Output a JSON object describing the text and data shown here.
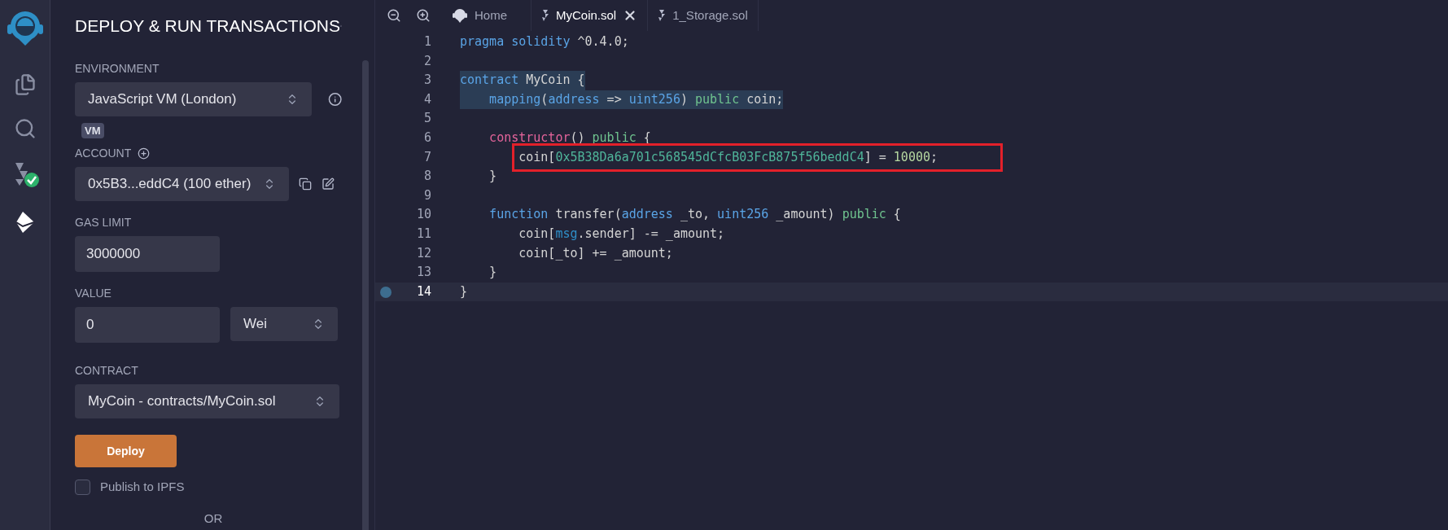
{
  "icon_bar": [
    {
      "kind": "logo"
    },
    {
      "kind": "files",
      "selected": false
    },
    {
      "kind": "search",
      "selected": false
    },
    {
      "kind": "compiler",
      "selected": false
    },
    {
      "kind": "deploy",
      "selected": true
    }
  ],
  "panel": {
    "title": "DEPLOY & RUN TRANSACTIONS",
    "environment": {
      "label": "ENVIRONMENT",
      "value": "JavaScript VM (London)",
      "badge": "VM"
    },
    "account": {
      "label": "ACCOUNT",
      "value": "0x5B3...eddC4 (100 ether)"
    },
    "gas_limit": {
      "label": "GAS LIMIT",
      "value": "3000000"
    },
    "value": {
      "label": "VALUE",
      "value": "0",
      "unit": "Wei"
    },
    "contract": {
      "label": "CONTRACT",
      "value": "MyCoin - contracts/MyCoin.sol"
    },
    "deploy_button": "Deploy",
    "publish": {
      "label": "Publish to IPFS",
      "checked": false
    },
    "separator": "OR"
  },
  "tabs": [
    {
      "label": "Home",
      "kind": "home",
      "selected": false,
      "closable": false
    },
    {
      "label": "MyCoin.sol",
      "kind": "file",
      "selected": true,
      "closable": true
    },
    {
      "label": "1_Storage.sol",
      "kind": "file",
      "selected": false,
      "closable": false
    }
  ],
  "code": [
    {
      "number": "1",
      "selected": false,
      "current": false,
      "breakpoint": false,
      "boxed": false,
      "tokens": [
        {
          "text": "pragma solidity",
          "kind": "keyword"
        },
        {
          "text": " ^0.4.0;",
          "kind": "plain"
        }
      ]
    },
    {
      "number": "2",
      "selected": false,
      "current": false,
      "breakpoint": false,
      "boxed": false
    },
    {
      "number": "3",
      "selected": true,
      "current": false,
      "breakpoint": false,
      "boxed": false,
      "tokens": [
        {
          "text": "contract",
          "kind": "keyword"
        },
        {
          "text": " MyCoin {",
          "kind": "plain"
        }
      ]
    },
    {
      "number": "4",
      "selected": true,
      "current": false,
      "breakpoint": false,
      "boxed": false,
      "tokens": [
        {
          "text": "    mapping",
          "kind": "keyword"
        },
        {
          "text": "(",
          "kind": "plain"
        },
        {
          "text": "address",
          "kind": "keyword"
        },
        {
          "text": " => ",
          "kind": "plain"
        },
        {
          "text": "uint256",
          "kind": "keyword"
        },
        {
          "text": ") ",
          "kind": "plain"
        },
        {
          "text": "public",
          "kind": "modifier"
        },
        {
          "text": " coin;",
          "kind": "plain"
        }
      ]
    },
    {
      "number": "5",
      "selected": false,
      "current": false,
      "breakpoint": false,
      "boxed": false
    },
    {
      "number": "6",
      "selected": false,
      "current": false,
      "breakpoint": false,
      "boxed": false,
      "tokens": [
        {
          "text": "    constructor",
          "kind": "special"
        },
        {
          "text": "() ",
          "kind": "plain"
        },
        {
          "text": "public",
          "kind": "modifier"
        },
        {
          "text": " {",
          "kind": "plain"
        }
      ]
    },
    {
      "number": "7",
      "selected": false,
      "current": false,
      "breakpoint": false,
      "boxed": true,
      "tokens": [
        {
          "text": "        coin[",
          "kind": "plain"
        },
        {
          "text": "0x5B38Da6a701c568545dCfcB03FcB875f56beddC4",
          "kind": "literal"
        },
        {
          "text": "] = ",
          "kind": "plain"
        },
        {
          "text": "10000",
          "kind": "number"
        },
        {
          "text": ";",
          "kind": "plain"
        }
      ]
    },
    {
      "number": "8",
      "selected": false,
      "current": false,
      "breakpoint": false,
      "boxed": false,
      "tokens": [
        {
          "text": "    }",
          "kind": "plain"
        }
      ]
    },
    {
      "number": "9",
      "selected": false,
      "current": false,
      "breakpoint": false,
      "boxed": false
    },
    {
      "number": "10",
      "selected": false,
      "current": false,
      "breakpoint": false,
      "boxed": false,
      "tokens": [
        {
          "text": "    function",
          "kind": "keyword"
        },
        {
          "text": " transfer(",
          "kind": "plain"
        },
        {
          "text": "address",
          "kind": "keyword"
        },
        {
          "text": " _to, ",
          "kind": "plain"
        },
        {
          "text": "uint256",
          "kind": "keyword"
        },
        {
          "text": " _amount) ",
          "kind": "plain"
        },
        {
          "text": "public",
          "kind": "modifier"
        },
        {
          "text": " {",
          "kind": "plain"
        }
      ]
    },
    {
      "number": "11",
      "selected": false,
      "current": false,
      "breakpoint": false,
      "boxed": false,
      "tokens": [
        {
          "text": "        coin[",
          "kind": "plain"
        },
        {
          "text": "msg",
          "kind": "global"
        },
        {
          "text": ".sender] -= _amount;",
          "kind": "plain"
        }
      ]
    },
    {
      "number": "12",
      "selected": false,
      "current": false,
      "breakpoint": false,
      "boxed": false,
      "tokens": [
        {
          "text": "        coin[_to] += _amount;",
          "kind": "plain"
        }
      ]
    },
    {
      "number": "13",
      "selected": false,
      "current": false,
      "breakpoint": false,
      "boxed": false,
      "tokens": [
        {
          "text": "    }",
          "kind": "plain"
        }
      ]
    },
    {
      "number": "14",
      "selected": false,
      "current": true,
      "breakpoint": true,
      "boxed": false,
      "tokens": [
        {
          "text": "}",
          "kind": "plain"
        }
      ]
    }
  ]
}
